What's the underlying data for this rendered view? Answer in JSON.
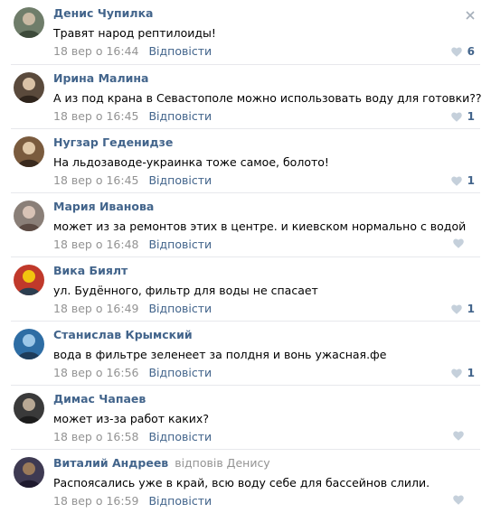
{
  "colors": {
    "author": "#42648b",
    "muted": "#939393",
    "like_icon": "#c5d0db",
    "divider": "#e7e8ec"
  },
  "close_icon": "close-icon",
  "comments": [
    {
      "author": "Денис Чупилка",
      "reply_to": "",
      "text": "Травят народ рептилоиды!",
      "date": "18 вер о 16:44",
      "reply_label": "Відповісти",
      "likes": "6",
      "avatar": "avatar-photo"
    },
    {
      "author": "Ирина Малина",
      "reply_to": "",
      "text": "А из под крана в Севастополе можно использовать воду для готовки??",
      "date": "18 вер о 16:45",
      "reply_label": "Відповісти",
      "likes": "1",
      "avatar": "avatar-photo"
    },
    {
      "author": "Нугзар Геденидзе",
      "reply_to": "",
      "text": "На льдозаводе-украинка тоже самое, болото!",
      "date": "18 вер о 16:45",
      "reply_label": "Відповісти",
      "likes": "1",
      "avatar": "avatar-photo"
    },
    {
      "author": "Мария Иванова",
      "reply_to": "",
      "text": "может из за ремонтов этих в центре. и киевском нормально с водой",
      "date": "18 вер о 16:48",
      "reply_label": "Відповісти",
      "likes": "",
      "avatar": "avatar-photo"
    },
    {
      "author": "Вика Биялт",
      "reply_to": "",
      "text": "ул. Будённого, фильтр для воды не спасает",
      "date": "18 вер о 16:49",
      "reply_label": "Відповісти",
      "likes": "1",
      "avatar": "avatar-photo"
    },
    {
      "author": "Станислав Крымский",
      "reply_to": "",
      "text": "вода в фильтре зеленеет за полдня и вонь ужасная.фе",
      "date": "18 вер о 16:56",
      "reply_label": "Відповісти",
      "likes": "1",
      "avatar": "avatar-photo"
    },
    {
      "author": "Димас Чапаев",
      "reply_to": "",
      "text": "может из-за работ каких?",
      "date": "18 вер о 16:58",
      "reply_label": "Відповісти",
      "likes": "",
      "avatar": "avatar-photo"
    },
    {
      "author": "Виталий Андреев",
      "reply_to": "відповів Денису",
      "text": "Распоясались уже в край, всю воду себе для бассейнов слили.",
      "date": "18 вер о 16:59",
      "reply_label": "Відповісти",
      "likes": "",
      "avatar": "avatar-photo"
    }
  ]
}
